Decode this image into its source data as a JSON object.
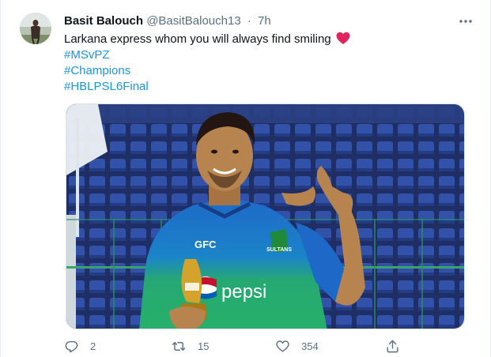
{
  "tweet": {
    "author_name": "Basit Balouch",
    "handle": "@BasitBalouch13",
    "separator": "·",
    "time": "7h",
    "text_lines": [
      "Larkana express whom you will always find smiling",
      "#MSvPZ",
      "#Champions",
      "#HBLPSL6Final"
    ],
    "emoji": "red-heart",
    "media": {
      "description_icon": "photo",
      "jersey_brand": "GFC",
      "jersey_sponsor": "pepsi",
      "badge_text": "SULTANS"
    }
  },
  "actions": {
    "reply_count": "2",
    "retweet_count": "15",
    "like_count": "354"
  },
  "colors": {
    "hashtag": "#1b95e0",
    "muted": "#5b7083",
    "heart": "#e0245e",
    "stadium_seat": "#2f4a9c",
    "jersey_blue": "#1e69c8",
    "jersey_green": "#27b06a"
  }
}
